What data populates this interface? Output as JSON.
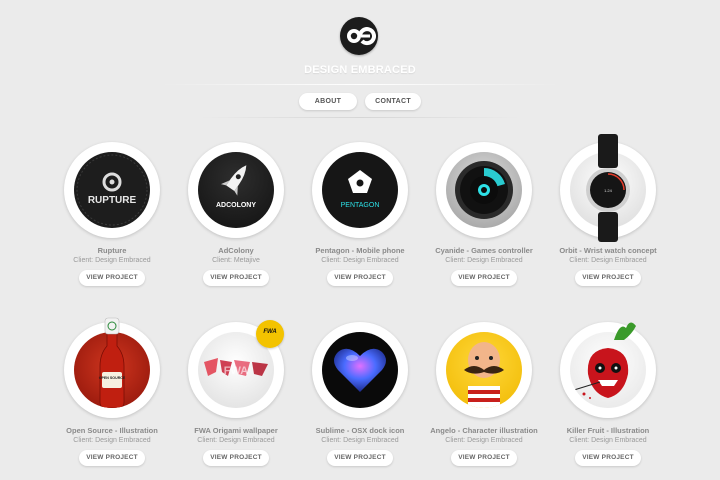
{
  "header": {
    "brand": "DESIGN EMBRACED",
    "nav": [
      {
        "label": "ABOUT"
      },
      {
        "label": "CONTACT"
      }
    ]
  },
  "projects": [
    {
      "title": "Rupture",
      "client": "Client: Design Embraced",
      "button": "VIEW PROJECT",
      "art_label": "RUPTURE"
    },
    {
      "title": "AdColony",
      "client": "Client: Metajive",
      "button": "VIEW PROJECT",
      "art_label": "ADCOLONY"
    },
    {
      "title": "Pentagon - Mobile phone",
      "client": "Client: Design Embraced",
      "button": "VIEW PROJECT",
      "art_label": "PENTAGON"
    },
    {
      "title": "Cyanide - Games controller",
      "client": "Client: Design Embraced",
      "button": "VIEW PROJECT"
    },
    {
      "title": "Orbit - Wrist watch concept",
      "client": "Client: Design Embraced",
      "button": "VIEW PROJECT",
      "art_label": "1.24"
    },
    {
      "title": "Open Source - Illustration",
      "client": "Client: Design Embraced",
      "button": "VIEW PROJECT",
      "art_label": "OPEN SOURCE"
    },
    {
      "title": "FWA Origami wallpaper",
      "client": "Client: Design Embraced",
      "button": "VIEW PROJECT",
      "art_label": "FWA",
      "badge": "FWA"
    },
    {
      "title": "Sublime - OSX dock icon",
      "client": "Client: Design Embraced",
      "button": "VIEW PROJECT"
    },
    {
      "title": "Angelo - Character illustration",
      "client": "Client: Design Embraced",
      "button": "VIEW PROJECT"
    },
    {
      "title": "Killer Fruit - Illustration",
      "client": "Client: Design Embraced",
      "button": "VIEW PROJECT"
    }
  ],
  "colors": {
    "background": "#ebebeb",
    "cyan_accent": "#2de0e6",
    "badge_yellow": "#f3c300",
    "ketchup_red": "#c01f10"
  }
}
